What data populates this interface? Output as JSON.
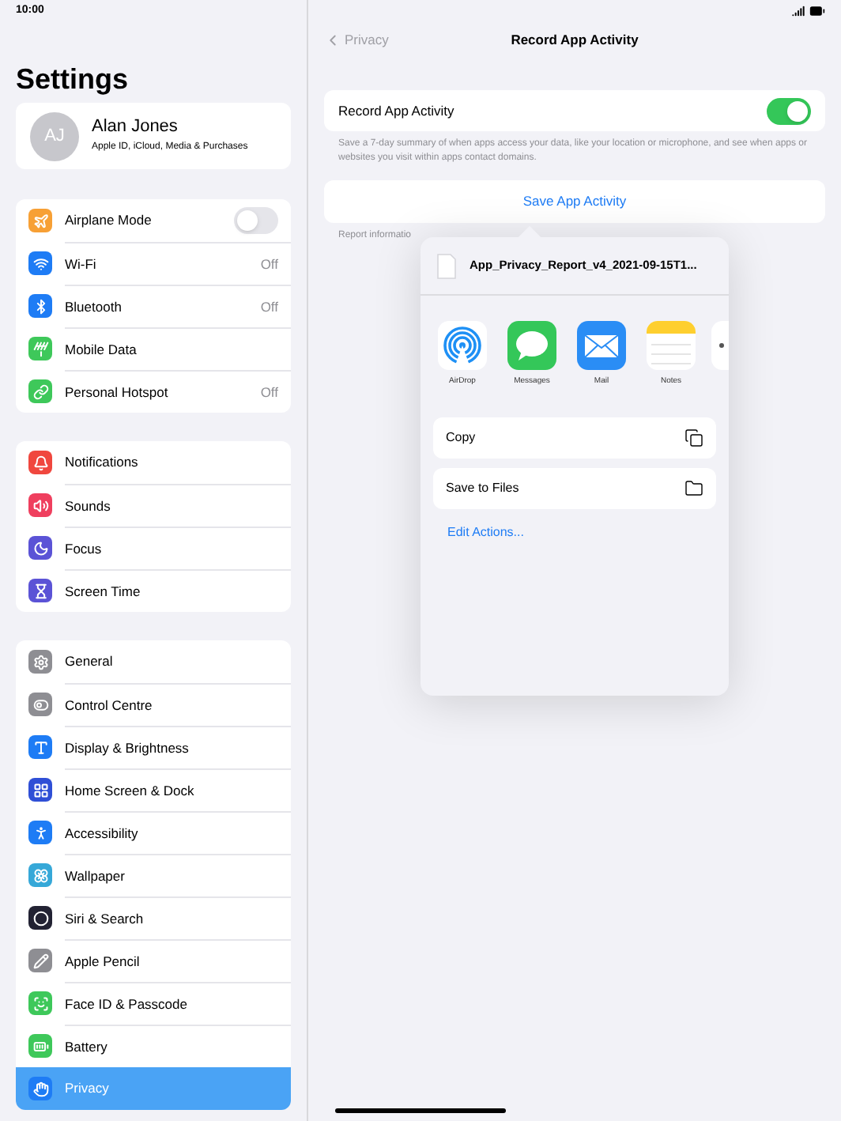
{
  "status_bar": {
    "time": "10:00"
  },
  "sidebar": {
    "title": "Settings",
    "profile": {
      "initials": "AJ",
      "name": "Alan Jones",
      "subtitle": "Apple ID, iCloud, Media & Purchases"
    },
    "groups": [
      {
        "items": [
          {
            "label": "Airplane Mode",
            "color": "#f7a035",
            "kind": "toggle",
            "on": false,
            "selected": false
          },
          {
            "label": "Wi-Fi",
            "color": "#1e7cf5",
            "kind": "value",
            "value": "Off",
            "selected": false
          },
          {
            "label": "Bluetooth",
            "color": "#1e7cf5",
            "kind": "value",
            "value": "Off",
            "selected": false
          },
          {
            "label": "Mobile Data",
            "color": "#3ec85a",
            "kind": "plain",
            "selected": false
          },
          {
            "label": "Personal Hotspot",
            "color": "#3ec85a",
            "kind": "value",
            "value": "Off",
            "selected": false
          }
        ]
      },
      {
        "items": [
          {
            "label": "Notifications",
            "color": "#f0473e",
            "kind": "plain",
            "selected": false
          },
          {
            "label": "Sounds",
            "color": "#ef3f5e",
            "kind": "plain",
            "selected": false
          },
          {
            "label": "Focus",
            "color": "#5b53d6",
            "kind": "plain",
            "selected": false
          },
          {
            "label": "Screen Time",
            "color": "#5b53d6",
            "kind": "plain",
            "selected": false
          }
        ]
      },
      {
        "items": [
          {
            "label": "General",
            "color": "#8e8e93",
            "kind": "plain",
            "selected": false
          },
          {
            "label": "Control Centre",
            "color": "#8e8e93",
            "kind": "plain",
            "selected": false
          },
          {
            "label": "Display & Brightness",
            "color": "#1e7cf5",
            "kind": "plain",
            "selected": false
          },
          {
            "label": "Home Screen & Dock",
            "color": "#2f4fd6",
            "kind": "plain",
            "selected": false
          },
          {
            "label": "Accessibility",
            "color": "#1e7cf5",
            "kind": "plain",
            "selected": false
          },
          {
            "label": "Wallpaper",
            "color": "#36a8d8",
            "kind": "plain",
            "selected": false
          },
          {
            "label": "Siri & Search",
            "color": "#222233",
            "kind": "plain",
            "selected": false
          },
          {
            "label": "Apple Pencil",
            "color": "#8e8e93",
            "kind": "plain",
            "selected": false
          },
          {
            "label": "Face ID & Passcode",
            "color": "#3ec85a",
            "kind": "plain",
            "selected": false
          },
          {
            "label": "Battery",
            "color": "#3ec85a",
            "kind": "plain",
            "selected": false
          },
          {
            "label": "Privacy",
            "color": "#1e7cf5",
            "kind": "plain",
            "selected": true
          }
        ]
      }
    ]
  },
  "detail": {
    "back": "Privacy",
    "title": "Record App Activity",
    "toggle_row": {
      "label": "Record App Activity",
      "on": true
    },
    "footnote": "Save a 7-day summary of when apps access your data, like your location or microphone, and see when apps or websites you visit within apps contact domains.",
    "save_button": "Save App Activity",
    "report_note": "Report informatio"
  },
  "share_sheet": {
    "file_name": "App_Privacy_Report_v4_2021-09-15T1...",
    "apps": [
      {
        "label": "AirDrop"
      },
      {
        "label": "Messages"
      },
      {
        "label": "Mail"
      },
      {
        "label": "Notes"
      }
    ],
    "actions": [
      {
        "label": "Copy"
      },
      {
        "label": "Save to Files"
      }
    ],
    "edit_actions": "Edit Actions..."
  }
}
